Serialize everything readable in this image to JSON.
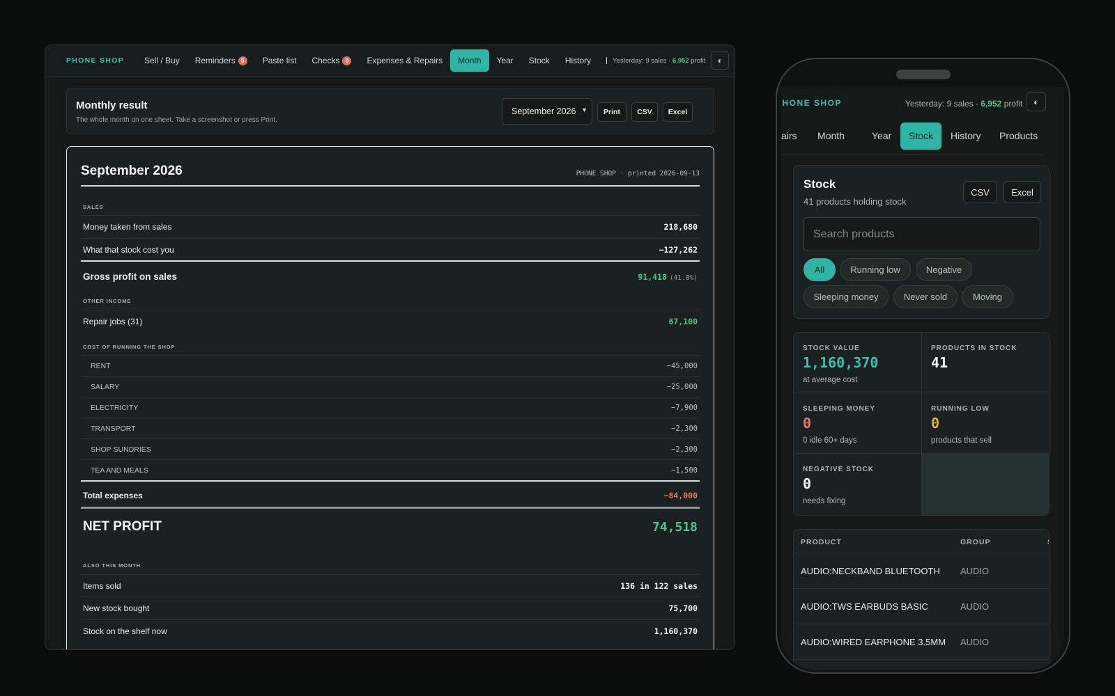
{
  "desktop": {
    "brand": "PHONE SHOP",
    "nav": [
      {
        "label": "Sell / Buy"
      },
      {
        "label": "Reminders",
        "badge": "5"
      },
      {
        "label": "Paste list"
      },
      {
        "label": "Checks",
        "badge": "0"
      },
      {
        "label": "Expenses & Repairs"
      },
      {
        "label": "Month",
        "active": true
      },
      {
        "label": "Year"
      },
      {
        "label": "Stock"
      },
      {
        "label": "History"
      }
    ],
    "yesterday_prefix": "Yesterday: 9 sales · ",
    "yesterday_profit": "6,952",
    "yesterday_suffix": " profit",
    "theme_icon": "◐",
    "header": {
      "title": "Monthly result",
      "subtitle": "The whole month on one sheet. Take a screenshot or press Print.",
      "month_select": "September 2026",
      "print": "Print",
      "csv": "CSV",
      "excel": "Excel"
    },
    "sheet": {
      "title": "September 2026",
      "printed": "PHONE SHOP · printed 2026-09-13",
      "sales_label": "SALES",
      "money_taken_label": "Money taken from sales",
      "money_taken_value": "218,680",
      "stock_cost_label": "What that stock cost you",
      "stock_cost_value": "−127,262",
      "gross_label": "Gross profit on sales",
      "gross_value": "91,418",
      "gross_pct": "(41.8%)",
      "other_income_label": "OTHER INCOME",
      "repair_label": "Repair jobs (31)",
      "repair_value": "67,100",
      "running_label": "COST OF RUNNING THE SHOP",
      "expenses": [
        {
          "label": "RENT",
          "value": "−45,000"
        },
        {
          "label": "SALARY",
          "value": "−25,000"
        },
        {
          "label": "ELECTRICITY",
          "value": "−7,900"
        },
        {
          "label": "TRANSPORT",
          "value": "−2,300"
        },
        {
          "label": "SHOP SUNDRIES",
          "value": "−2,300"
        },
        {
          "label": "TEA AND MEALS",
          "value": "−1,500"
        }
      ],
      "total_expenses_label": "Total expenses",
      "total_expenses_value": "−84,000",
      "net_label": "NET PROFIT",
      "net_value": "74,518",
      "also_label": "ALSO THIS MONTH",
      "items_sold_label": "Items sold",
      "items_sold_value": "136 in 122 sales",
      "new_stock_label": "New stock bought",
      "new_stock_value": "75,700",
      "shelf_label": "Stock on the shelf now",
      "shelf_value": "1,160,370"
    }
  },
  "phone": {
    "brand": "PHONE SHOP",
    "yesterday_prefix": "Yesterday: 9 sales · ",
    "yesterday_profit": "6,952",
    "yesterday_suffix": " profit",
    "theme_icon": "◐",
    "nav": [
      "airs",
      "Month",
      "Year",
      "Stock",
      "History",
      "Products"
    ],
    "active_nav": "Stock",
    "stock": {
      "title": "Stock",
      "subtitle": "41 products holding stock",
      "csv": "CSV",
      "excel": "Excel",
      "search_placeholder": "Search products",
      "filters": [
        "All",
        "Running low",
        "Negative",
        "Sleeping money",
        "Never sold",
        "Moving"
      ],
      "active_filter": "All"
    },
    "stats": [
      {
        "label": "STOCK VALUE",
        "value": "1,160,370",
        "note": "at average cost",
        "color": "#3bbfae"
      },
      {
        "label": "PRODUCTS IN STOCK",
        "value": "41",
        "note": "",
        "color": "#f4f7f6"
      },
      {
        "label": "SLEEPING MONEY",
        "value": "0",
        "note": "0 idle 60+ days",
        "color": "#e07a5f"
      },
      {
        "label": "RUNNING LOW",
        "value": "0",
        "note": "products that sell",
        "color": "#e0b040"
      },
      {
        "label": "NEGATIVE STOCK",
        "value": "0",
        "note": "needs fixing",
        "color": "#f4f7f6"
      }
    ],
    "table": {
      "headers": [
        "PRODUCT",
        "GROUP",
        "S"
      ],
      "rows": [
        {
          "product": "AUDIO:NECKBAND BLUETOOTH",
          "group": "AUDIO"
        },
        {
          "product": "AUDIO:TWS EARBUDS BASIC",
          "group": "AUDIO"
        },
        {
          "product": "AUDIO:WIRED EARPHONE 3.5MM",
          "group": "AUDIO"
        }
      ]
    }
  }
}
